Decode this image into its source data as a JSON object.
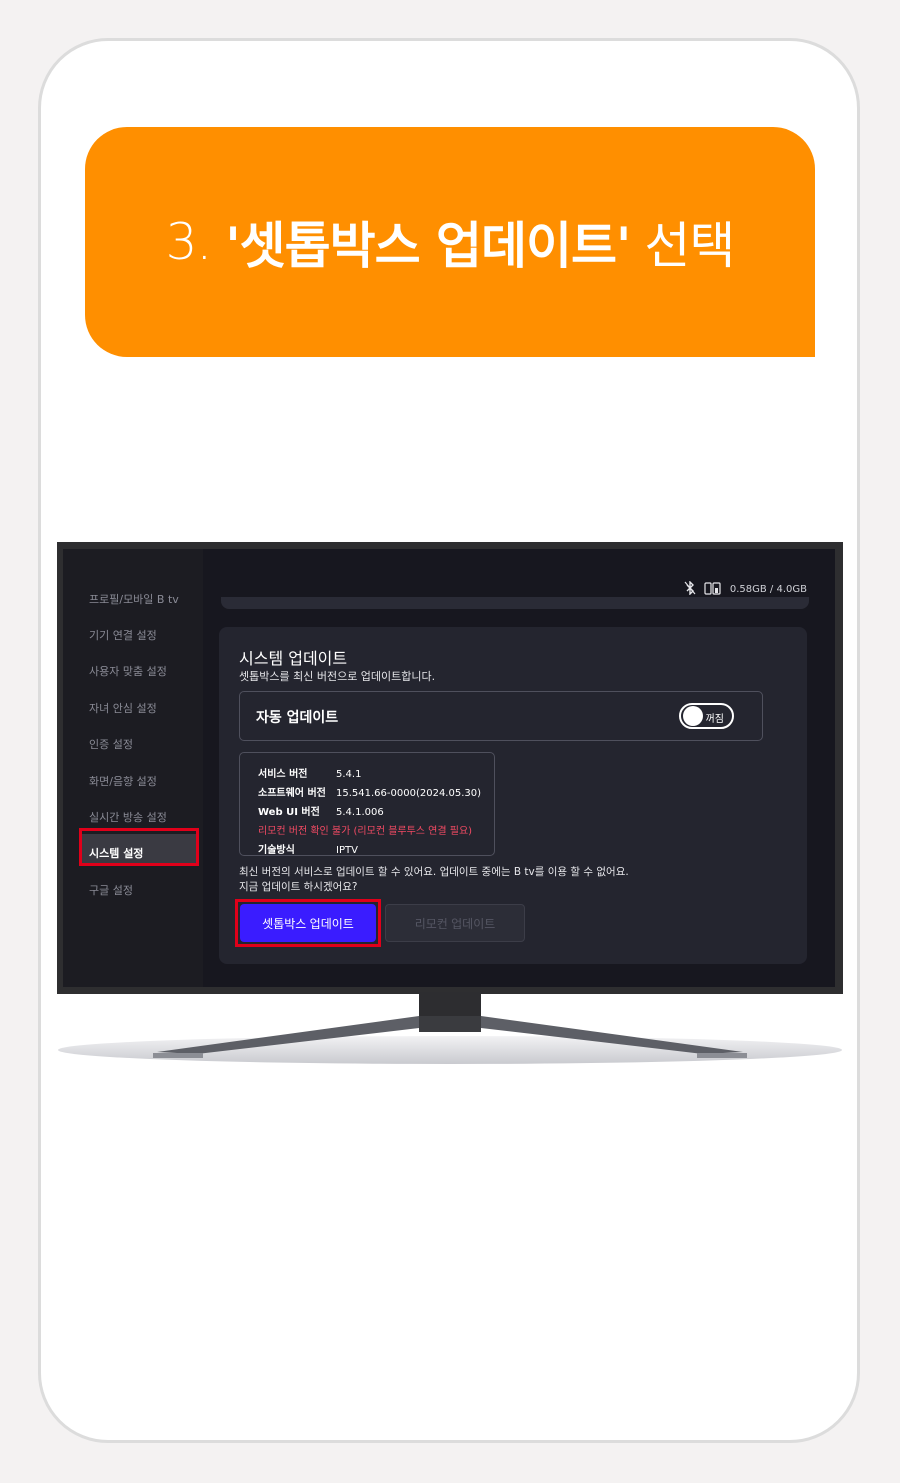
{
  "banner": {
    "step": "3.",
    "quoted": "'셋톱박스 업데이트'",
    "verb": "선택",
    "color": "#ff8f00"
  },
  "status_bar": {
    "icons": [
      "bluetooth-off-icon",
      "remote-battery-icon"
    ],
    "storage": "0.58GB / 4.0GB"
  },
  "sidebar": {
    "items": [
      {
        "label": "프로필/모바일 B tv"
      },
      {
        "label": "기기 연결 설정"
      },
      {
        "label": "사용자 맞춤 설정"
      },
      {
        "label": "자녀 안심 설정"
      },
      {
        "label": "인증 설정"
      },
      {
        "label": "화면/음향 설정"
      },
      {
        "label": "실시간 방송 설정"
      },
      {
        "label": "시스템 설정",
        "active": true
      },
      {
        "label": "구글 설정"
      }
    ]
  },
  "system_update": {
    "title": "시스템 업데이트",
    "subtitle": "셋톱박스를 최신 버전으로 업데이트합니다.",
    "auto_update": {
      "label": "자동 업데이트",
      "toggle_state": "꺼짐",
      "on": false
    },
    "info": [
      {
        "key": "서비스 버전",
        "value": "5.4.1"
      },
      {
        "key": "소프트웨어 버전",
        "value": "15.541.66-0000(2024.05.30)"
      },
      {
        "key": "Web UI 버전",
        "value": "5.4.1.006"
      },
      {
        "warning": "리모컨 버전 확인 불가 (리모컨 블루투스 연결 필요)"
      },
      {
        "key": "기술방식",
        "value": "IPTV"
      }
    ],
    "note_line1": "최신 버전의 서비스로 업데이트 할 수 있어요. 업데이트 중에는 B tv를 이용 할 수 없어요.",
    "note_line2": "지금 업데이트 하시겠어요?",
    "primary_button": "셋톱박스 업데이트",
    "secondary_button": "리모컨 업데이트"
  },
  "colors": {
    "highlight": "#e0001a",
    "primary_button": "#3a1cff",
    "warning_text": "#f24a63"
  }
}
